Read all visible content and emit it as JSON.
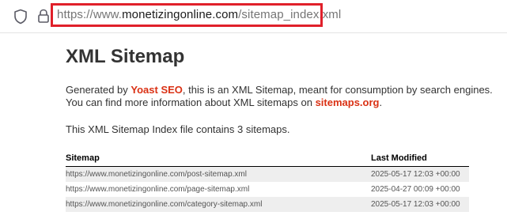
{
  "browser": {
    "url_prefix": "https://www.",
    "url_domain": "monetizingonline.com",
    "url_path": "/sitemap_index.xml"
  },
  "page": {
    "title": "XML Sitemap",
    "intro_part1": "Generated by ",
    "yoast_link": "Yoast SEO",
    "intro_part2": ", this is an XML Sitemap, meant for consumption by search engines.",
    "intro_part3": "You can find more information about XML sitemaps on ",
    "sitemaps_link": "sitemaps.org",
    "intro_part4": ".",
    "count_text": "This XML Sitemap Index file contains 3 sitemaps."
  },
  "table": {
    "headers": [
      "Sitemap",
      "Last Modified"
    ],
    "rows": [
      {
        "sitemap": "https://www.monetizingonline.com/post-sitemap.xml",
        "modified": "2025-05-17 12:03 +00:00"
      },
      {
        "sitemap": "https://www.monetizingonline.com/page-sitemap.xml",
        "modified": "2025-04-27 00:09 +00:00"
      },
      {
        "sitemap": "https://www.monetizingonline.com/category-sitemap.xml",
        "modified": "2025-05-17 12:03 +00:00"
      }
    ]
  },
  "icons": {
    "shield": "shield-icon",
    "lock": "lock-icon"
  },
  "colors": {
    "link": "#da3114",
    "highlight_border": "#e0202a",
    "row_stripe": "#eeeeee"
  }
}
